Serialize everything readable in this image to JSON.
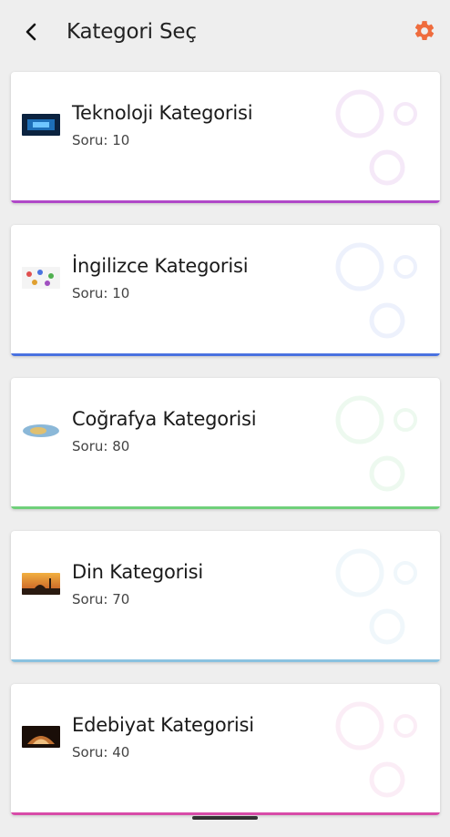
{
  "header": {
    "title": "Kategori Seç",
    "back_icon": "chevron-left-icon",
    "settings_icon": "gear-icon",
    "settings_color": "#ef6c3d"
  },
  "categories": [
    {
      "name": "Teknoloji Kategorisi",
      "count": "Soru: 10",
      "accent": "#b048c8",
      "thumb": "technology-thumbnail"
    },
    {
      "name": "İngilizce Kategorisi",
      "count": "Soru: 10",
      "accent": "#4a72e0",
      "thumb": "english-thumbnail"
    },
    {
      "name": "Coğrafya Kategorisi",
      "count": "Soru: 80",
      "accent": "#6fd07a",
      "thumb": "geography-thumbnail"
    },
    {
      "name": "Din Kategorisi",
      "count": "Soru: 70",
      "accent": "#8ac2e0",
      "thumb": "religion-thumbnail"
    },
    {
      "name": "Edebiyat Kategorisi",
      "count": "Soru: 40",
      "accent": "#d84ba8",
      "thumb": "literature-thumbnail"
    }
  ]
}
